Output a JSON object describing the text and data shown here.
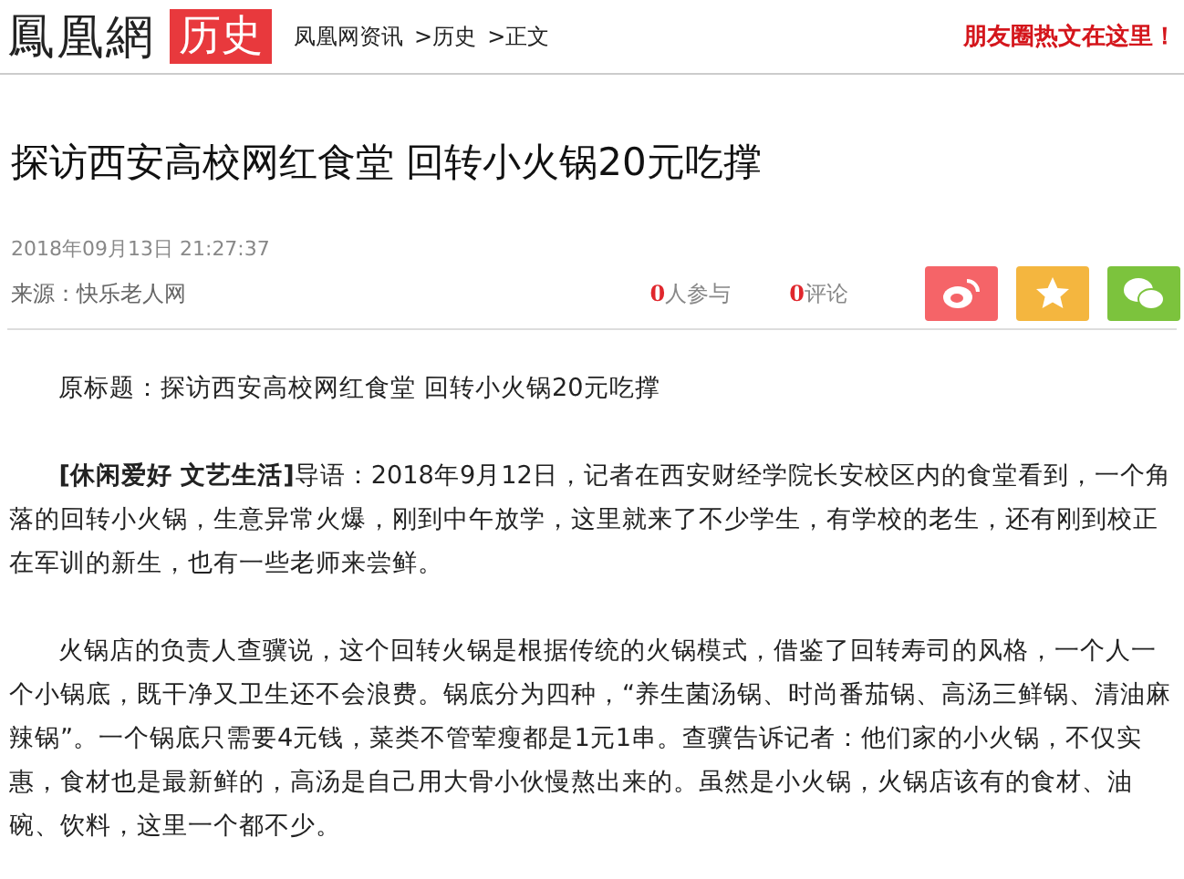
{
  "header": {
    "logo": "鳳凰網",
    "channel": "历史",
    "breadcrumb": [
      "凤凰网资讯",
      ">历史",
      ">正文"
    ],
    "promo": "朋友圈热文在这里！"
  },
  "article": {
    "title": "探访西安高校网红食堂  回转小火锅20元吃撑",
    "datetime": "2018年09月13日 21:27:37",
    "source": "来源：快乐老人网",
    "stats": [
      {
        "count": "0",
        "label": "人参与"
      },
      {
        "count": "0",
        "label": "评论"
      }
    ],
    "share": [
      {
        "kind": "weibo",
        "color": "#f56468"
      },
      {
        "kind": "favorite",
        "color": "#f4b63f"
      },
      {
        "kind": "wechat",
        "color": "#7cc33d"
      }
    ]
  },
  "body": [
    "原标题：探访西安高校网红食堂  回转小火锅20元吃撑",
    "**[休闲爱好  文艺生活]**导语：2018年9月12日，记者在西安财经学院长安校区内的食堂看到，一个角落的回转小火锅，生意异常火爆，刚到中午放学，这里就来了不少学生，有学校的老生，还有刚到校正在军训的新生，也有一些老师来尝鲜。",
    "火锅店的负责人查骥说，这个回转火锅是根据传统的火锅模式，借鉴了回转寿司的风格，一个人一个小锅底，既干净又卫生还不会浪费。锅底分为四种，“养生菌汤锅、时尚番茄锅、高汤三鲜锅、清油麻辣锅”。一个锅底只需要4元钱，菜类不管荤瘦都是1元1串。查骥告诉记者：他们家的小火锅，不仅实惠，食材也是最新鲜的，高汤是自己用大骨小伙慢熬出来的。虽然是小火锅，火锅店该有的食材、油碗、饮料，这里一个都不少。"
  ]
}
